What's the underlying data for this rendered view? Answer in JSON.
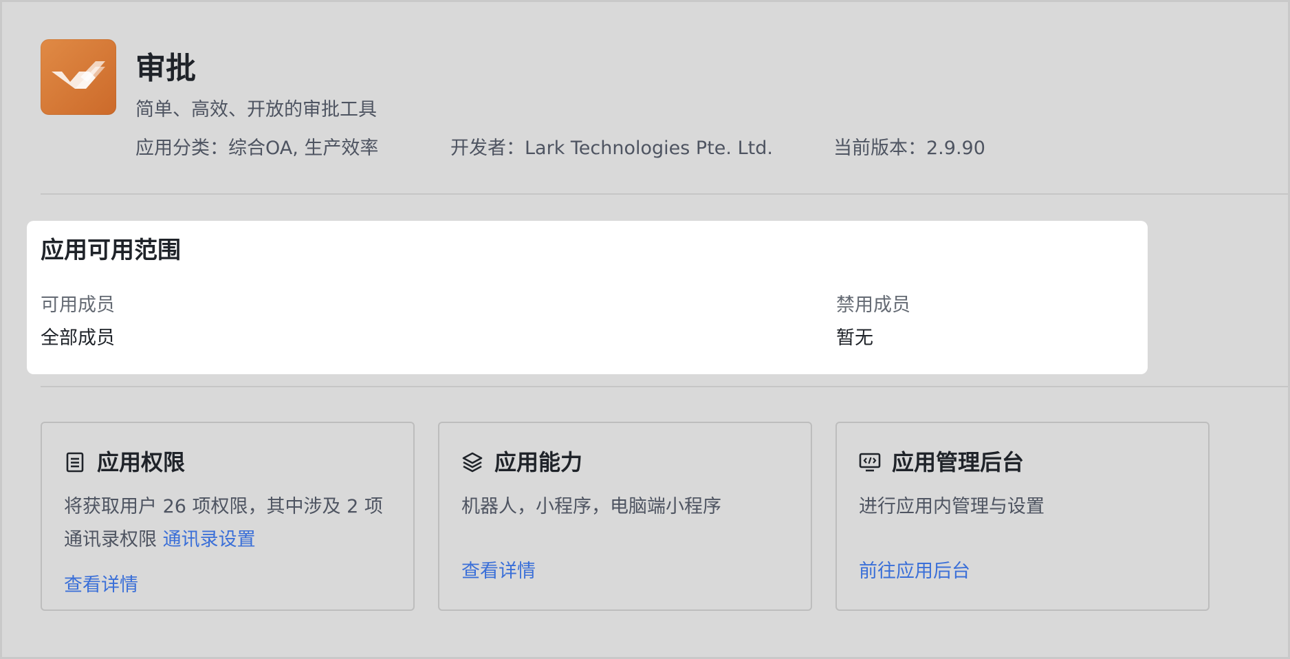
{
  "app": {
    "name": "审批",
    "description": "简单、高效、开放的审批工具",
    "icon": "approval-check-icon",
    "icon_color": "#d8783a",
    "meta": {
      "category": "应用分类：综合OA, 生产效率",
      "developer": "开发者：Lark Technologies Pte. Ltd.",
      "version": "当前版本：2.9.90"
    }
  },
  "scope": {
    "title": "应用可用范围",
    "available_label": "可用成员",
    "available_value": "全部成员",
    "disabled_label": "禁用成员",
    "disabled_value": "暂无"
  },
  "cards": {
    "permissions": {
      "icon": "document-list-icon",
      "title": "应用权限",
      "desc": "将获取用户 26 项权限，其中涉及 2 项通讯录权限",
      "inline_link": "通讯录设置",
      "link": "查看详情"
    },
    "capabilities": {
      "icon": "layers-icon",
      "title": "应用能力",
      "desc": "机器人，小程序，电脑端小程序",
      "link": "查看详情"
    },
    "admin": {
      "icon": "code-monitor-icon",
      "title": "应用管理后台",
      "desc": "进行应用内管理与设置",
      "link": "前往应用后台"
    }
  },
  "colors": {
    "background": "#d9d9d9",
    "panel": "#ffffff",
    "link": "#3a6fd8",
    "text": "#1f2329"
  }
}
